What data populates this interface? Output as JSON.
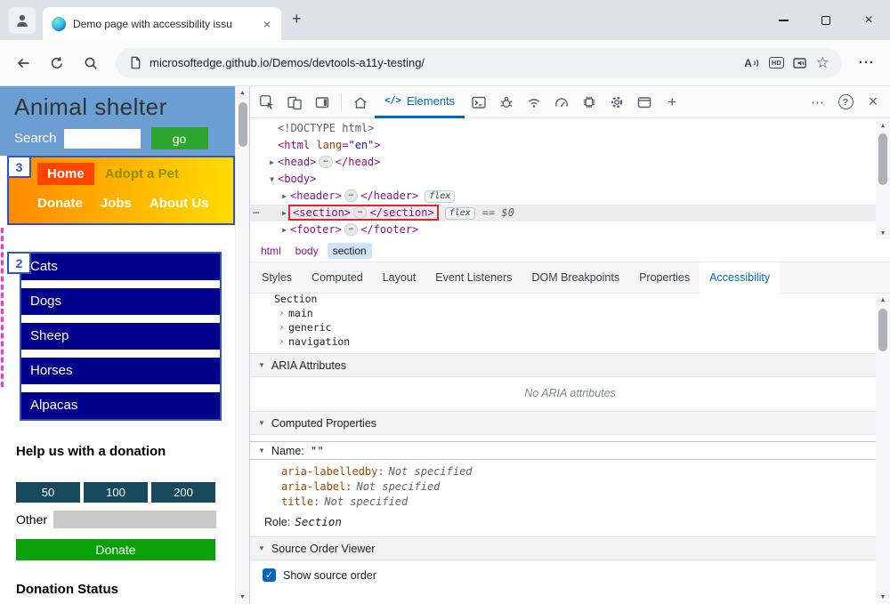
{
  "colors": {
    "header_blue": "#6b9fd3",
    "nav_gradient_left": "#ff8a00",
    "nav_gradient_right": "#ffdc00",
    "home_chip_red": "#ff4500",
    "category_navy": "#00008b",
    "go_green": "#2da42d",
    "donate_green": "#0aa10a",
    "amount_teal": "#17495d",
    "source_order_badge_blue": "#2d53c9",
    "source_order_outline_pink": "#ff33cc",
    "devtools_accent_blue": "#0067c4",
    "selection_highlight_red": "#e3242b"
  },
  "icons": {
    "plus": "+",
    "close": "×",
    "more_h": "···",
    "dots": "⋯",
    "help": "?",
    "star": "☆",
    "hd": "HD",
    "read_aloud": "A",
    "code": "</>",
    "up": "▲",
    "down": "▼",
    "check": "✓"
  },
  "chrome": {
    "tab_title": "Demo page with accessibility issu",
    "url": "microsoftedge.github.io/Demos/devtools-a11y-testing/"
  },
  "page": {
    "title": "Animal shelter",
    "search_label": "Search",
    "go": "go",
    "badge_nav": "3",
    "badge_list": "2",
    "nav_row1": [
      "Home",
      "Adopt a Pet"
    ],
    "nav_row2": [
      "Donate",
      "Jobs",
      "About Us"
    ],
    "categories": [
      "Cats",
      "Dogs",
      "Sheep",
      "Horses",
      "Alpacas"
    ],
    "donation_heading": "Help us with a donation",
    "amounts": [
      "50",
      "100",
      "200"
    ],
    "other_label": "Other",
    "donate": "Donate",
    "status_heading": "Donation Status"
  },
  "devtools": {
    "elements_label": "Elements",
    "dom_rows": [
      {
        "indent": 0,
        "arrow": "",
        "tokens": [
          {
            "c": "doctype",
            "t": "<!DOCTYPE html>"
          }
        ]
      },
      {
        "indent": 0,
        "arrow": "",
        "tokens": [
          {
            "c": "tag",
            "t": "<html"
          },
          {
            "c": "attr",
            "t": " lang"
          },
          {
            "c": "tag",
            "t": "="
          },
          {
            "c": "val",
            "t": "\"en\""
          },
          {
            "c": "tag",
            "t": ">"
          }
        ]
      },
      {
        "indent": 0,
        "arrow": "▶",
        "tokens": [
          {
            "c": "tag",
            "t": "<head>"
          },
          {
            "c": "dots",
            "t": "⋯"
          },
          {
            "c": "tag",
            "t": "</head>"
          }
        ]
      },
      {
        "indent": 0,
        "arrow": "▼",
        "tokens": [
          {
            "c": "tag",
            "t": "<body>"
          }
        ]
      },
      {
        "indent": 1,
        "arrow": "▶",
        "tokens": [
          {
            "c": "tag",
            "t": "<header>"
          },
          {
            "c": "dots",
            "t": "⋯"
          },
          {
            "c": "tag",
            "t": "</header>"
          },
          {
            "c": "flexbadge",
            "t": "flex"
          }
        ]
      },
      {
        "indent": 1,
        "arrow": "▶",
        "selected": true,
        "gutter": "⋯",
        "box": [
          {
            "c": "tag",
            "t": "<section>"
          },
          {
            "c": "dots",
            "t": "⋯"
          },
          {
            "c": "tag",
            "t": "</section>"
          }
        ],
        "tokens": [
          {
            "c": "flexbadge",
            "t": "flex"
          },
          {
            "c": "dollar",
            "t": "== $0"
          }
        ]
      },
      {
        "indent": 1,
        "arrow": "▶",
        "tokens": [
          {
            "c": "tag",
            "t": "<footer>"
          },
          {
            "c": "dots",
            "t": "⋯"
          },
          {
            "c": "tag",
            "t": "</footer>"
          }
        ]
      }
    ],
    "crumbs": [
      "html",
      "body",
      "section"
    ],
    "tabs": [
      "Styles",
      "Computed",
      "Layout",
      "Event Listeners",
      "DOM Breakpoints",
      "Properties",
      "Accessibility"
    ],
    "active_tab": "Accessibility",
    "a11y": {
      "tree": [
        {
          "label": "Section",
          "indent": 0,
          "chevron": ""
        },
        {
          "label": "main",
          "indent": 1,
          "chevron": "›"
        },
        {
          "label": "generic",
          "indent": 1,
          "chevron": "›"
        },
        {
          "label": "navigation",
          "indent": 1,
          "chevron": "›"
        }
      ],
      "aria_header": "ARIA Attributes",
      "no_aria": "No ARIA attributes",
      "computed_header": "Computed Properties",
      "name_label": "Name:",
      "name_value": "\"\"",
      "props": [
        {
          "name": "aria-labelledby",
          "value": "Not specified"
        },
        {
          "name": "aria-label",
          "value": "Not specified"
        },
        {
          "name": "title",
          "value": "Not specified"
        }
      ],
      "role_label": "Role:",
      "role_value": "Section",
      "source_header": "Source Order Viewer",
      "checkbox_label": "Show source order"
    }
  }
}
